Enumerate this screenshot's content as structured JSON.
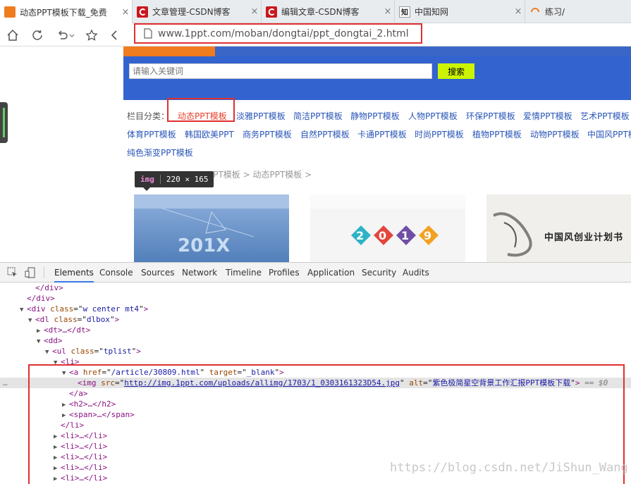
{
  "browser": {
    "tabs": [
      {
        "title": "动态PPT模板下载_免费",
        "icon": "ppt-favicon",
        "active": true
      },
      {
        "title": "文章管理-CSDN博客",
        "icon": "csdn-favicon",
        "active": false
      },
      {
        "title": "编辑文章-CSDN博客",
        "icon": "csdn-favicon",
        "active": false
      },
      {
        "title": "中国知网",
        "icon": "cnki-favicon",
        "active": false
      },
      {
        "title": "练习/",
        "icon": "loading-icon",
        "active": false
      }
    ],
    "tab_close_glyph": "×",
    "cnki_favicon_text": "知",
    "url": "www.1ppt.com/moban/dongtai/ppt_dongtai_2.html"
  },
  "site": {
    "search": {
      "placeholder": "请输入关键词",
      "button": "搜索"
    },
    "category_label": "栏目分类：",
    "categories": [
      "动态PPT模板",
      "淡雅PPT模板",
      "简洁PPT模板",
      "静物PPT模板",
      "人物PPT模板",
      "环保PPT模板",
      "爱情PPT模板",
      "艺术PPT模板",
      "体育PPT模板",
      "韩国欧美PPT",
      "商务PPT模板",
      "自然PPT模板",
      "卡通PPT模板",
      "时尚PPT模板",
      "植物PPT模板",
      "动物PPT模板",
      "中国风PPT模板",
      "纯色渐变PPT模板"
    ],
    "active_category": "动态PPT模板",
    "breadcrumb": "PPT模板 > 动态PPT模板 >",
    "thumbnail_1_text": "201X",
    "thumbnail_2_digits": [
      "2",
      "0",
      "1",
      "9"
    ],
    "thumbnail_3_text": "中国风创业计划书"
  },
  "tooltip": {
    "tag": "img",
    "size": "220 × 165"
  },
  "devtools": {
    "tabs": [
      "Elements",
      "Console",
      "Sources",
      "Network",
      "Timeline",
      "Profiles",
      "Application",
      "Security",
      "Audits"
    ],
    "active_tab": "Elements",
    "dom": {
      "close_div": "</div>",
      "div_tag": "div",
      "div_class": "w center mt4",
      "dl_tag": "dl",
      "dl_class": "dlbox",
      "dt_line": "<dt>…</dt>",
      "dd_line": "<dd>",
      "ul_tag": "ul",
      "ul_class": "tplist",
      "li_open": "<li>",
      "a_tag": "a",
      "a_href": "/article/30809.html",
      "a_target": "_blank",
      "img_tag": "img",
      "img_src": "http://img.1ppt.com/uploads/allimg/1703/1_0303161323D54.jpg",
      "img_alt": "紫色极简星空背景工作汇报PPT模板下载",
      "eq_marker": "== $0",
      "close_a": "</a>",
      "h2_line": "<h2>…</h2>",
      "span_line": "<span>…</span>",
      "close_li": "</li>",
      "li_collapsed": "<li>…</li>",
      "ellipsis": "…"
    }
  },
  "watermark": "https://blog.csdn.net/JiShun_Wang",
  "colors": {
    "highlight": "#e03030",
    "link": "#2a56b8",
    "accent_blue": "#3263cf"
  }
}
